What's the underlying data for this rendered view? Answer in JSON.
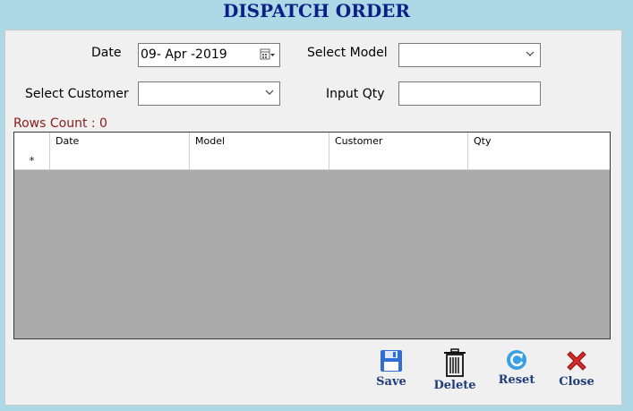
{
  "window": {
    "title": "DISPATCH ORDER"
  },
  "form": {
    "date_label": "Date",
    "date_value": "09- Apr -2019",
    "model_label": "Select Model",
    "model_value": "",
    "customer_label": "Select Customer",
    "customer_value": "",
    "qty_label": "Input Qty",
    "qty_value": ""
  },
  "rows_count": "Rows Count : 0",
  "grid": {
    "columns": [
      "",
      "Date",
      "Model",
      "Customer",
      "Qty"
    ],
    "new_row_marker": "*"
  },
  "actions": {
    "save": "Save",
    "delete": "Delete",
    "reset": "Reset",
    "close": "Close"
  },
  "colors": {
    "background": "#add8e6",
    "title": "#0b1f87",
    "rows_count": "#8b1a1a",
    "grid_empty": "#ababab",
    "button_label": "#1f3d7a"
  }
}
